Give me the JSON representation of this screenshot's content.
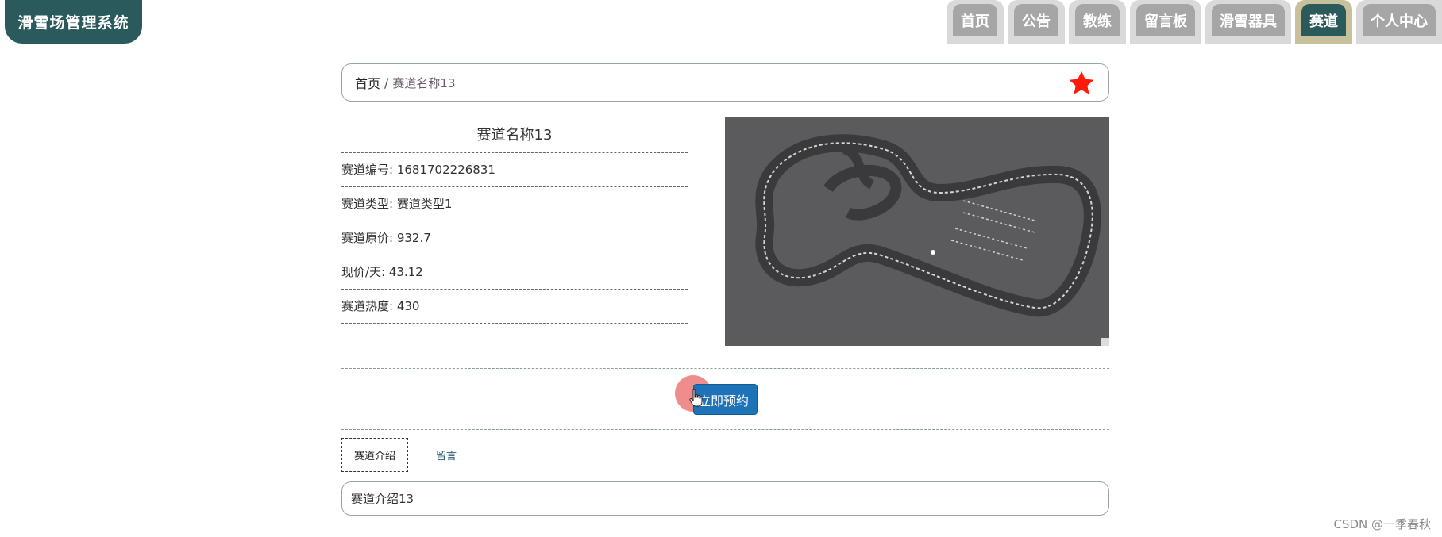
{
  "app": {
    "title": "滑雪场管理系统"
  },
  "nav": {
    "items": [
      {
        "label": "首页",
        "active": false
      },
      {
        "label": "公告",
        "active": false
      },
      {
        "label": "教练",
        "active": false
      },
      {
        "label": "留言板",
        "active": false
      },
      {
        "label": "滑雪器具",
        "active": false
      },
      {
        "label": "赛道",
        "active": true
      },
      {
        "label": "个人中心",
        "active": false
      }
    ]
  },
  "breadcrumb": {
    "home": "首页",
    "separator": "/",
    "current": "赛道名称13",
    "favorite_icon": "star-icon"
  },
  "detail": {
    "name": "赛道名称13",
    "fields": [
      {
        "label": "赛道编号",
        "value": "1681702226831"
      },
      {
        "label": "赛道类型",
        "value": "赛道类型1"
      },
      {
        "label": "赛道原价",
        "value": "932.7"
      },
      {
        "label": "现价/天",
        "value": "43.12"
      },
      {
        "label": "赛道热度",
        "value": "430"
      }
    ]
  },
  "actions": {
    "book_label": "立即预约"
  },
  "tabs": [
    {
      "label": "赛道介绍",
      "active": true
    },
    {
      "label": "留言",
      "active": false
    }
  ],
  "description": "赛道介绍13",
  "watermark": "CSDN @一季春秋",
  "colors": {
    "primary": "#2b5a5c",
    "accent_gold": "#c7c09b",
    "button_blue": "#1e73b8",
    "star_red": "#ff1a0a"
  }
}
